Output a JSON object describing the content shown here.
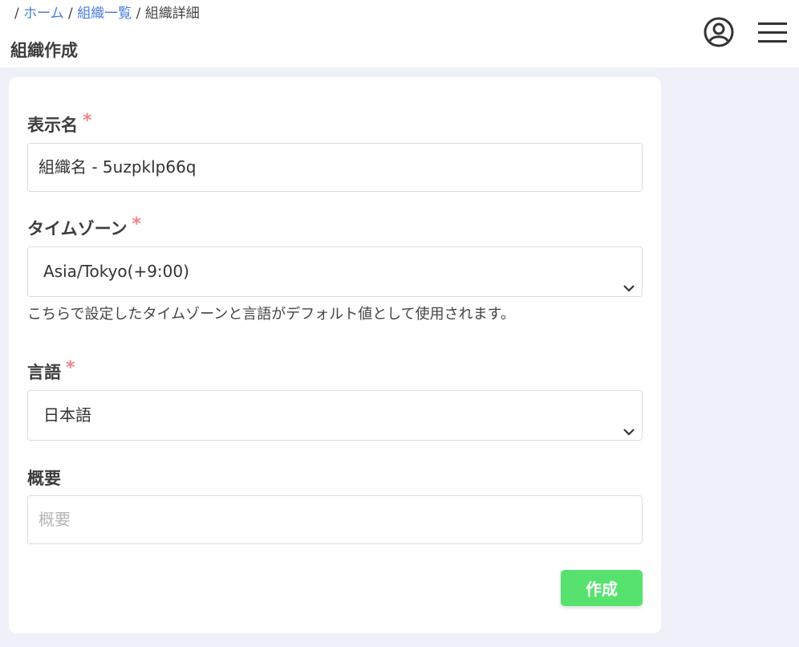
{
  "breadcrumb": {
    "sep1": "/",
    "home": "ホーム",
    "sep2": "/",
    "org_list": "組織一覧",
    "sep3": "/",
    "current": "組織詳細"
  },
  "header": {
    "title": "組織作成",
    "user_icon": "user-circle-icon",
    "menu_icon": "hamburger-menu-icon"
  },
  "form": {
    "display_name": {
      "label": "表示名",
      "required_mark": "*",
      "value": "組織名 - 5uzpklp66q"
    },
    "timezone": {
      "label": "タイムゾーン",
      "required_mark": "*",
      "selected": "Asia/Tokyo(+9:00)",
      "help": "こちらで設定したタイムゾーンと言語がデフォルト値として使用されます。"
    },
    "language": {
      "label": "言語",
      "required_mark": "*",
      "selected": "日本語"
    },
    "summary": {
      "label": "概要",
      "placeholder": "概要"
    },
    "submit_label": "作成"
  },
  "colors": {
    "accent_link": "#4a7ddb",
    "required": "#f0848c",
    "submit": "#57e26f",
    "background": "#eef1f8"
  }
}
